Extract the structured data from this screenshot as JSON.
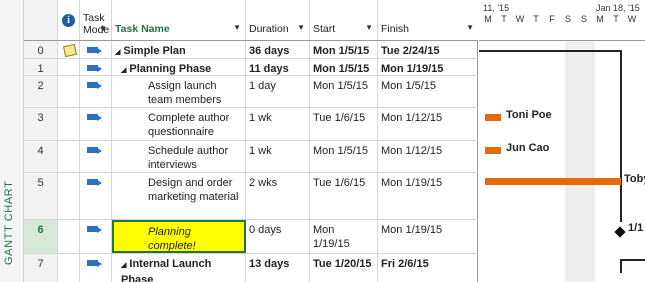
{
  "side_tab": "GANTT CHART",
  "columns": {
    "indicator": "i",
    "task_mode": [
      "Task",
      "Mode"
    ],
    "task_name": "Task Name",
    "duration": "Duration",
    "start": "Start",
    "finish": "Finish"
  },
  "rows": [
    {
      "id": "0",
      "name": "Simple Plan",
      "duration": "36 days",
      "start": "Mon 1/5/15",
      "finish": "Tue 2/24/15",
      "collapse": "◢",
      "bold": true
    },
    {
      "id": "1",
      "name": "Planning Phase",
      "duration": "11 days",
      "start": "Mon 1/5/15",
      "finish": "Mon 1/19/15",
      "collapse": "◢",
      "bold": true
    },
    {
      "id": "2",
      "name": "Assign launch team members",
      "duration": "1 day",
      "start": "Mon 1/5/15",
      "finish": "Mon 1/5/15"
    },
    {
      "id": "3",
      "name": "Complete author questionnaire",
      "duration": "1 wk",
      "start": "Tue 1/6/15",
      "finish": "Mon 1/12/15"
    },
    {
      "id": "4",
      "name": "Schedule author interviews",
      "duration": "1 wk",
      "start": "Mon 1/5/15",
      "finish": "Mon 1/12/15"
    },
    {
      "id": "5",
      "name": "Design and order marketing material",
      "duration": "2 wks",
      "start": "Tue 1/6/15",
      "finish": "Mon 1/19/15"
    },
    {
      "id": "6",
      "name": "Planning complete!",
      "duration": "0 days",
      "start": "Mon 1/19/15",
      "finish": "Mon 1/19/15"
    },
    {
      "id": "7",
      "name": "Internal Launch Phase",
      "duration": "13 days",
      "start": "Tue 1/20/15",
      "finish": "Fri 2/6/15",
      "collapse": "◢",
      "bold": true
    }
  ],
  "timescale": {
    "weeks": [
      "11, '15",
      "Jan 18, '15"
    ],
    "days": [
      "M",
      "T",
      "W",
      "T",
      "F",
      "S",
      "S",
      "M",
      "T",
      "W"
    ]
  },
  "gantt_labels": {
    "row3": "Toni Poe",
    "row4": "Jun Cao",
    "row5": "Toby",
    "milestone": "1/1"
  },
  "colors": {
    "accent": "#217346",
    "bar": "#e36c09",
    "selected_name_bg": "#ffff00"
  }
}
